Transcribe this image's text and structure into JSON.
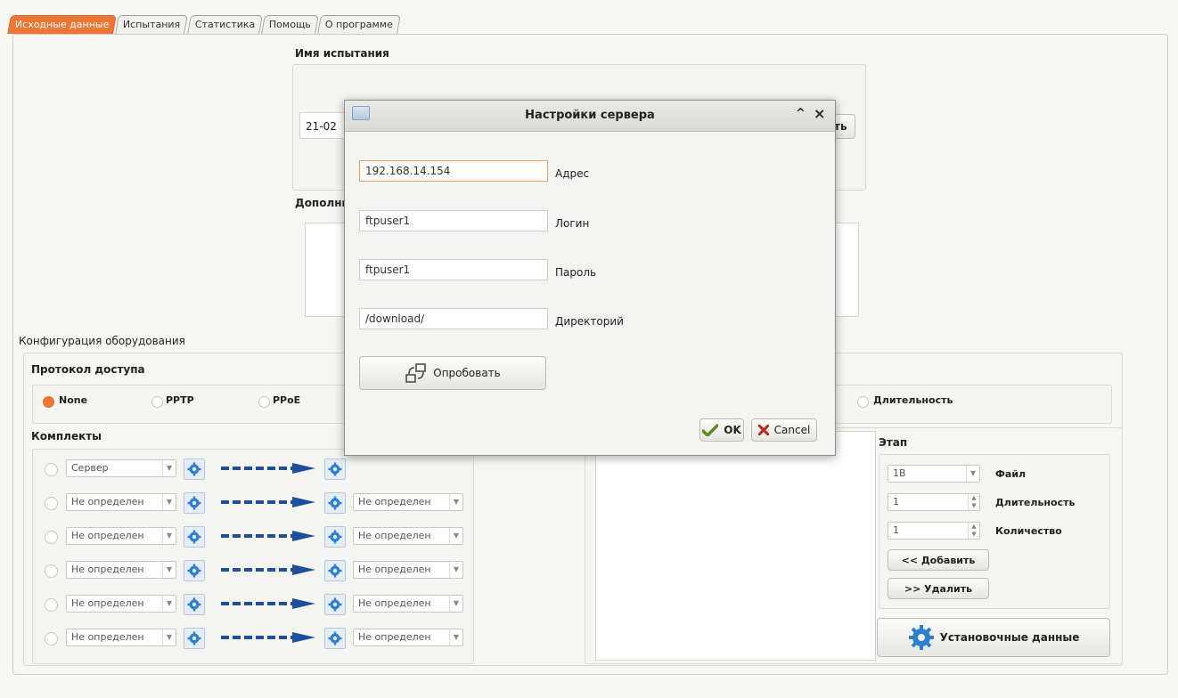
{
  "tabs": [
    "Исходные данные",
    "Испытания",
    "Статистика",
    "Помощь",
    "О программе"
  ],
  "test_name_label": "Имя испытания",
  "test_name_value": "21-02",
  "extra_label": "Дополни",
  "apply_button_partial": "ть",
  "equipment_label": "Конфигурация оборудования",
  "protocol_label": "Протокол доступа",
  "protocols": [
    "None",
    "PPTP",
    "PPoE"
  ],
  "duration_radio": "Длительность",
  "kits_label": "Комплекты",
  "kit_left": [
    "Сервер",
    "Не определен",
    "Не определен",
    "Не определен",
    "Не определен",
    "Не определен"
  ],
  "kit_right": [
    "",
    "Не определен",
    "Не определен",
    "Не определен",
    "Не определен",
    "Не определен"
  ],
  "stage": {
    "label": "Этап",
    "file_value": "1В",
    "file_label": "Файл",
    "duration_value": "1",
    "duration_label": "Длительность",
    "count_value": "1",
    "count_label": "Количество",
    "add_button": "<< Добавить",
    "remove_button": ">> Удалить"
  },
  "install_button": "Установочные данные",
  "dialog": {
    "title": "Настройки сервера",
    "address_value": "192.168.14.154",
    "address_label": "Адрес",
    "login_value": "ftpuser1",
    "login_label": "Логин",
    "password_value": "ftpuser1",
    "password_label": "Пароль",
    "dir_value": "/download/",
    "dir_label": "Директорий",
    "test_button": "Опробовать",
    "ok_button": "OK",
    "cancel_button": "Cancel"
  },
  "colors": {
    "accent": "#ee7634",
    "arrow": "#1f4f9a",
    "gear": "#2f7fd0"
  }
}
